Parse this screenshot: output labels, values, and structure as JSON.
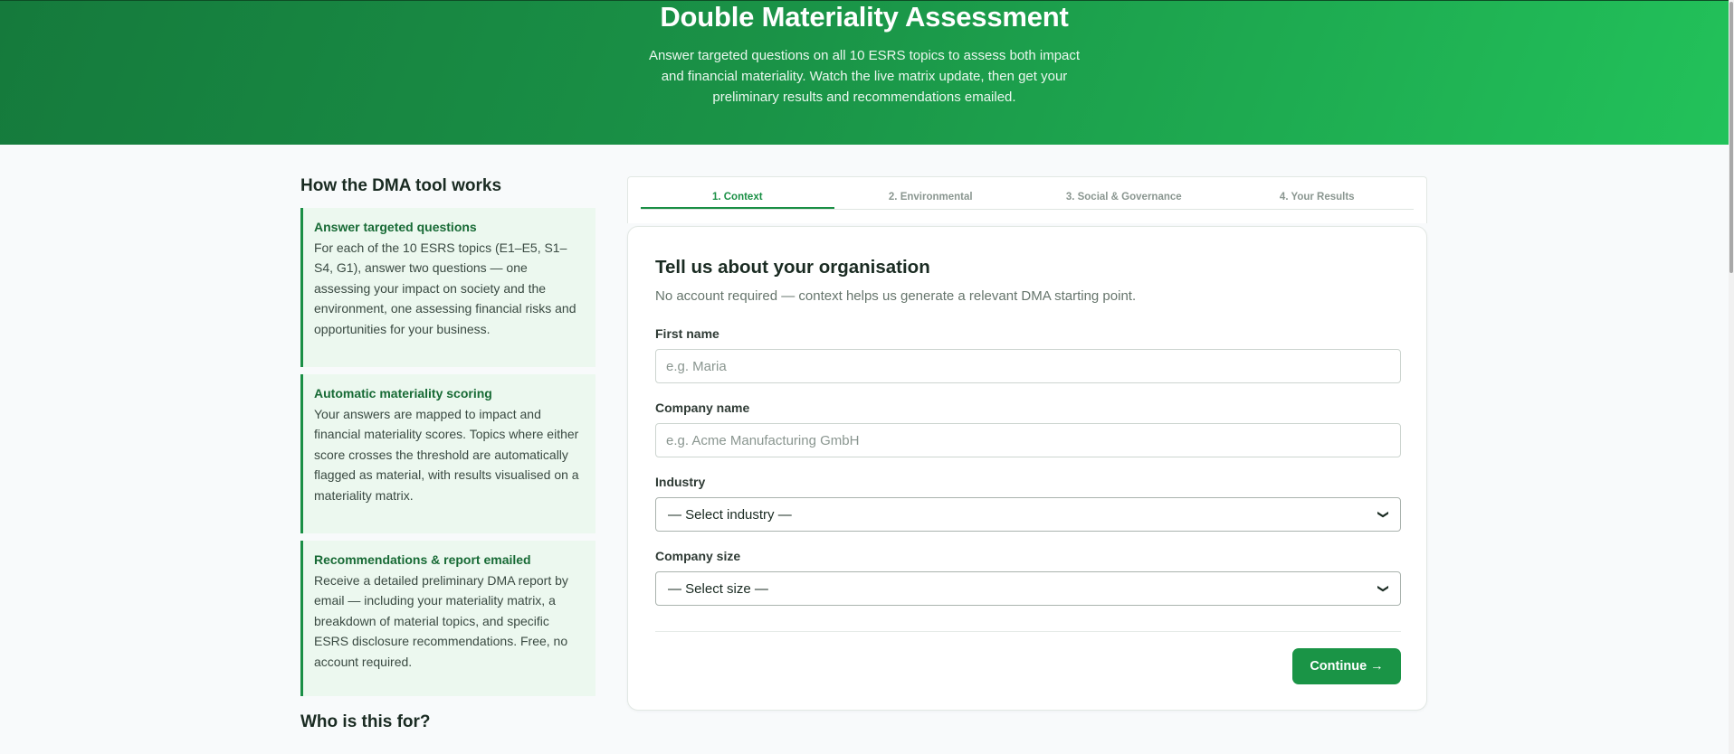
{
  "hero": {
    "title": "Double Materiality Assessment",
    "subtitle": "Answer targeted questions on all 10 ESRS topics to assess both impact and financial materiality. Watch the live matrix update, then get your preliminary results and recommendations emailed."
  },
  "how_it_works": {
    "heading": "How the DMA tool works",
    "steps": [
      {
        "title": "Answer targeted questions",
        "body": "For each of the 10 ESRS topics (E1–E5, S1–S4, G1), answer two questions — one assessing your impact on society and the environment, one assessing financial risks and opportunities for your business."
      },
      {
        "title": "Automatic materiality scoring",
        "body": "Your answers are mapped to impact and financial materiality scores. Topics where either score crosses the threshold are automatically flagged as material, with results visualised on a materiality matrix."
      },
      {
        "title": "Recommendations & report emailed",
        "body": "Receive a detailed preliminary DMA report by email — including your materiality matrix, a breakdown of material topics, and specific ESRS disclosure recommendations. Free, no account required."
      }
    ]
  },
  "who_heading": "Who is this for?",
  "tabs": [
    {
      "label": "1. Context",
      "active": true
    },
    {
      "label": "2. Environmental",
      "active": false
    },
    {
      "label": "3. Social & Governance",
      "active": false
    },
    {
      "label": "4. Your Results",
      "active": false
    }
  ],
  "form": {
    "title": "Tell us about your organisation",
    "subtitle": "No account required — context helps us generate a relevant DMA starting point.",
    "first_name": {
      "label": "First name",
      "placeholder": "e.g. Maria",
      "value": ""
    },
    "company_name": {
      "label": "Company name",
      "placeholder": "e.g. Acme Manufacturing GmbH",
      "value": ""
    },
    "industry": {
      "label": "Industry",
      "selected": "— Select industry —"
    },
    "company_size": {
      "label": "Company size",
      "selected": "— Select size —"
    },
    "continue_label": "Continue →"
  },
  "colors": {
    "accent": "#1a9446",
    "hero_start": "#157a3c",
    "hero_end": "#22c25a",
    "step_bg": "#ecf8ef"
  }
}
